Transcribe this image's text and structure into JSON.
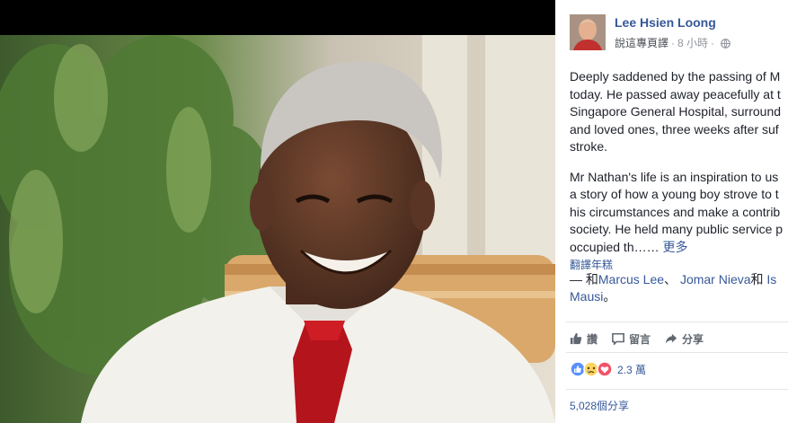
{
  "post": {
    "author": "Lee Hsien Loong",
    "translate_page": "說這專頁譯",
    "time": "8 小時",
    "dot": "·",
    "paragraph1": "Deeply saddened by the passing of M\ntoday. He passed away peacefully at t\nSingapore General Hospital, surround\nand loved ones, three weeks after suf\nstroke.",
    "paragraph2": "Mr Nathan's life is an inspiration to us\na story of how a young boy strove to t\nhis circumstances and make a contrib\nsociety. He held many public service p\noccupied th……",
    "see_more": "更多",
    "translate_link": "翻譯年糕",
    "tag_prefix": "— 和",
    "tag_person1": "Marcus Lee",
    "tag_sep1": "、 ",
    "tag_person2": "Jomar Nieva",
    "tag_and": "和 ",
    "tag_person3": "Is",
    "tag_line2": "Mausi",
    "tag_end": "。"
  },
  "actions": {
    "like": "讚",
    "comment": "留言",
    "share": "分享"
  },
  "stats": {
    "reaction_count": "2.3 萬",
    "share_count": "5,028個分享"
  },
  "colors": {
    "link": "#365899",
    "meta": "#90949c",
    "text": "#1d2129",
    "like_blue": "#5890ff",
    "love_red": "#f25268",
    "sad_yellow": "#fcd561"
  }
}
